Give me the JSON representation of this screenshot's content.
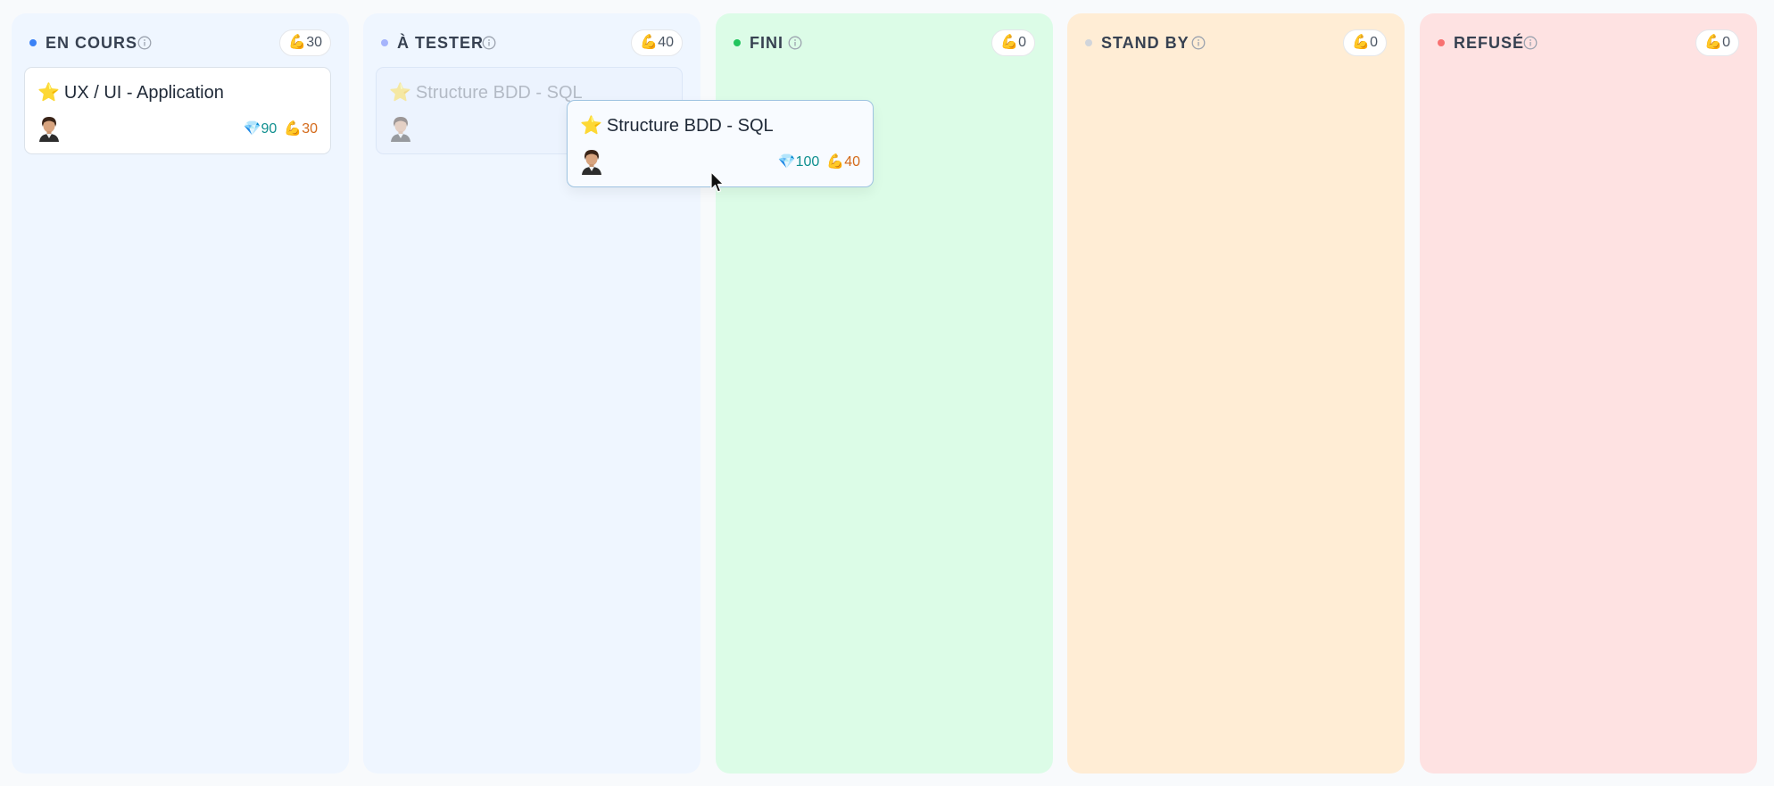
{
  "columns": [
    {
      "title": "EN COURS",
      "effort_icon": "flexed-biceps",
      "effort": "30",
      "accent": "#3b82f6",
      "background": "#eff6ff",
      "cards": [
        {
          "icon": "star",
          "title": "UX / UI - Application",
          "gems": "90",
          "effort": "30",
          "avatar": "male-avatar"
        }
      ]
    },
    {
      "title": "À TESTER",
      "effort_icon": "flexed-biceps",
      "effort": "40",
      "accent": "#a5b4fc",
      "background": "#eff6ff",
      "cards": [
        {
          "icon": "star",
          "title": "Structure BDD - SQL",
          "state": "drag-placeholder",
          "avatar": "male-avatar"
        }
      ]
    },
    {
      "title": "FINI",
      "effort_icon": "flexed-biceps",
      "effort": "0",
      "accent": "#22c55e",
      "background": "#dcfce7",
      "cards": []
    },
    {
      "title": "STAND BY",
      "effort_icon": "flexed-biceps",
      "effort": "0",
      "accent": "#d1d5db",
      "background": "#ffedd5",
      "cards": []
    },
    {
      "title": "REFUSÉ",
      "effort_icon": "flexed-biceps",
      "effort": "0",
      "accent": "#f87171",
      "background": "#fee2e2",
      "cards": []
    }
  ],
  "dragging_card": {
    "icon": "star",
    "title": "Structure BDD - SQL",
    "gems": "100",
    "effort": "40",
    "avatar": "male-avatar"
  },
  "icons": {
    "star": "⭐",
    "gem": "💎",
    "arm": "💪"
  }
}
